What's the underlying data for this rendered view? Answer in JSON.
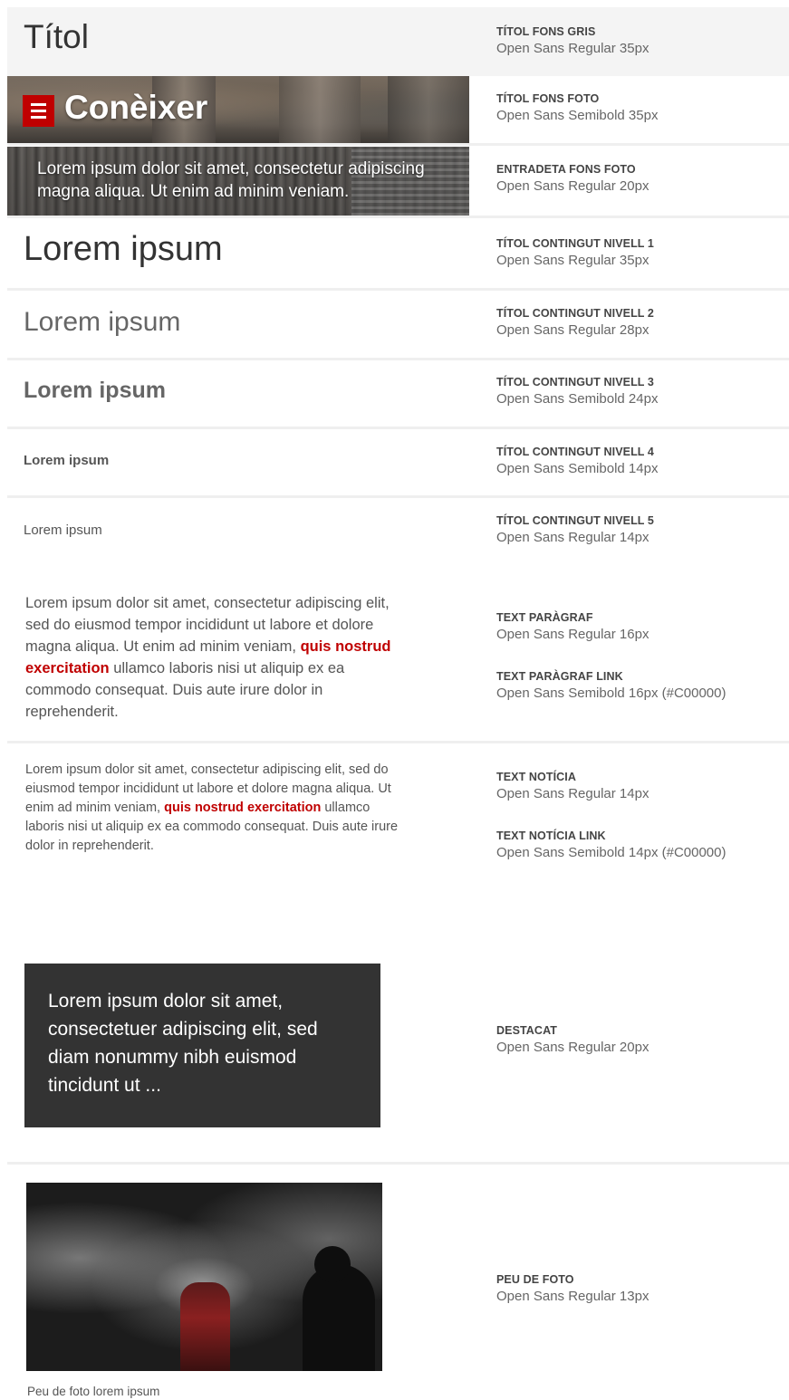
{
  "title_grey": {
    "text": "Títol"
  },
  "title_photo": {
    "text": "Conèixer"
  },
  "lead_photo": {
    "line1": "Lorem ipsum dolor sit amet, consectetur adipiscing",
    "line2": "magna aliqua. Ut enim ad minim veniam."
  },
  "headings": {
    "h1": "Lorem ipsum",
    "h2": "Lorem ipsum",
    "h3": "Lorem ipsum",
    "h4": "Lorem ipsum",
    "h5": "Lorem ipsum"
  },
  "paragraph": {
    "before": "Lorem ipsum dolor sit amet, consectetur adipiscing elit, sed do eiusmod tempor incididunt ut labore et dolore magna aliqua. Ut enim ad minim veniam, ",
    "link": "quis nostrud exercitation",
    "after": " ullamco laboris nisi ut aliquip ex ea commodo consequat. Duis aute irure dolor in reprehenderit."
  },
  "news": {
    "before": "Lorem ipsum dolor sit amet, consectetur adipiscing elit, sed do eiusmod tempor incididunt ut labore et dolore magna aliqua. Ut enim ad minim veniam, ",
    "link": "quis nostrud exercitation",
    "after": " ullamco laboris nisi ut aliquip ex ea commodo consequat. Duis aute irure dolor in reprehenderit."
  },
  "highlight": {
    "text": "Lorem ipsum dolor sit amet, consectetuer adipiscing elit, sed diam nonummy nibh euismod tincidunt ut ..."
  },
  "caption": {
    "text": "Peu de foto lorem ipsum"
  },
  "specs": {
    "titol_fons_gris": {
      "name": "TÍTOL FONS GRIS",
      "desc": "Open Sans Regular 35px"
    },
    "titol_fons_foto": {
      "name": "TÍTOL FONS FOTO",
      "desc": "Open Sans Semibold 35px"
    },
    "entradeta_fons_foto": {
      "name": "ENTRADETA FONS FOTO",
      "desc": "Open Sans Regular 20px"
    },
    "nivell1": {
      "name": "TÍTOL CONTINGUT NIVELL 1",
      "desc": "Open Sans Regular 35px"
    },
    "nivell2": {
      "name": "TÍTOL CONTINGUT  NIVELL 2",
      "desc": "Open Sans Regular 28px"
    },
    "nivell3": {
      "name": "TÍTOL CONTINGUT NIVELL 3",
      "desc": "Open Sans Semibold 24px"
    },
    "nivell4": {
      "name": "TÍTOL CONTINGUT NIVELL 4",
      "desc": "Open Sans Semibold 14px"
    },
    "nivell5": {
      "name": "TÍTOL CONTINGUT NIVELL 5",
      "desc": "Open Sans Regular 14px"
    },
    "text_paragraf": {
      "name": "TEXT PARÀGRAF",
      "desc": "Open Sans Regular 16px"
    },
    "text_paragraf_link": {
      "name": "TEXT PARÀGRAF LINK",
      "desc": "Open Sans Semibold 16px  (#C00000)"
    },
    "text_noticia": {
      "name": "TEXT NOTÍCIA",
      "desc": "Open Sans Regular 14px"
    },
    "text_noticia_link": {
      "name": "TEXT NOTÍCIA LINK",
      "desc": "Open Sans Semibold 14px  (#C00000)"
    },
    "destacat": {
      "name": "DESTACAT",
      "desc": "Open Sans Regular 20px"
    },
    "peu_de_foto": {
      "name": "PEU DE FOTO",
      "desc": "Open Sans Regular 13px"
    }
  },
  "colors": {
    "link": "#C00000",
    "highlight_bg": "#333333",
    "grey_bg": "#f4f4f4"
  },
  "icons": {
    "menu": "menu-icon"
  }
}
